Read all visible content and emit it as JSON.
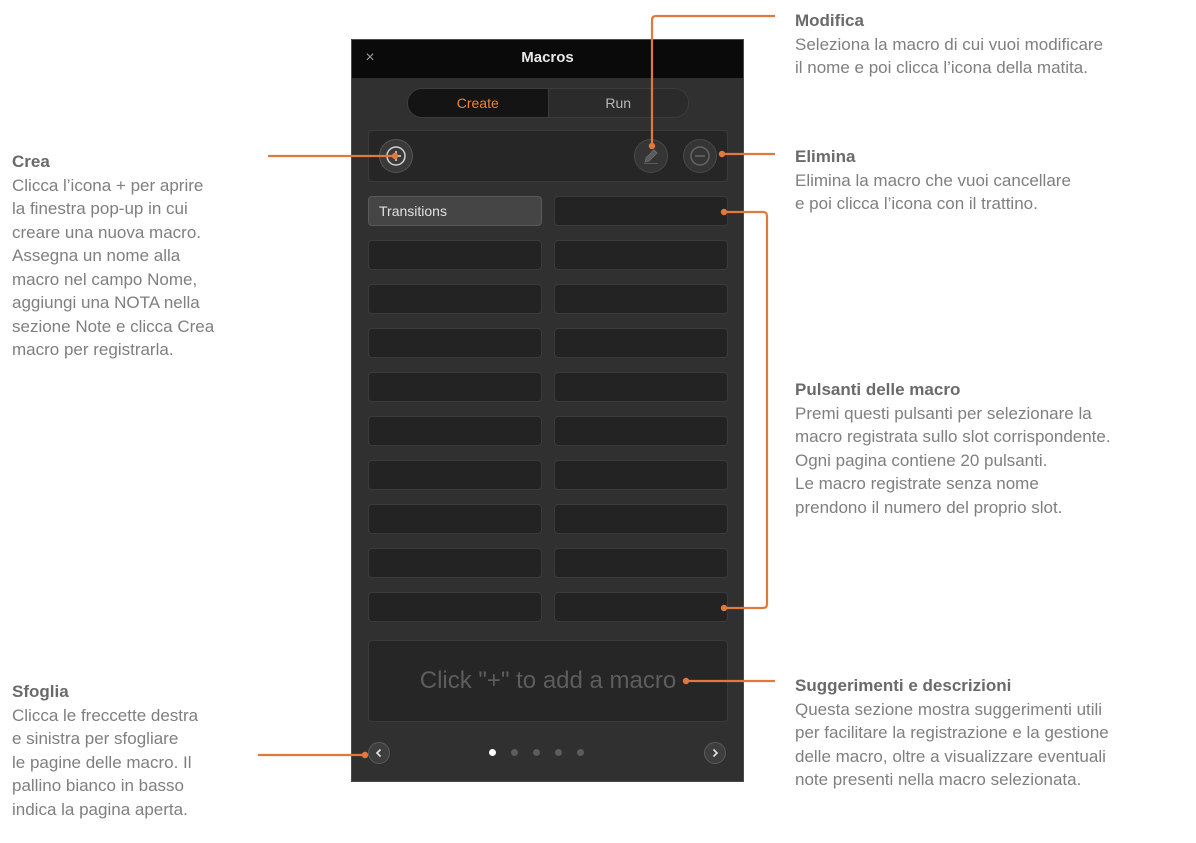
{
  "window": {
    "title": "Macros",
    "close_label": "×"
  },
  "mode_tabs": [
    {
      "label": "Create",
      "active": true
    },
    {
      "label": "Run",
      "active": false
    }
  ],
  "toolbar": {
    "add_icon": "plus-circle-icon",
    "edit_icon": "pencil-icon",
    "delete_icon": "minus-circle-icon"
  },
  "slots": [
    {
      "label": "Transitions"
    },
    {
      "label": ""
    },
    {
      "label": ""
    },
    {
      "label": ""
    },
    {
      "label": ""
    },
    {
      "label": ""
    },
    {
      "label": ""
    },
    {
      "label": ""
    },
    {
      "label": ""
    },
    {
      "label": ""
    },
    {
      "label": ""
    },
    {
      "label": ""
    },
    {
      "label": ""
    },
    {
      "label": ""
    },
    {
      "label": ""
    },
    {
      "label": ""
    },
    {
      "label": ""
    },
    {
      "label": ""
    },
    {
      "label": ""
    },
    {
      "label": ""
    }
  ],
  "hint": "Click \"+\" to add a macro",
  "pagination": {
    "pages": 5,
    "current": 1,
    "prev_icon": "chevron-left-icon",
    "next_icon": "chevron-right-icon"
  },
  "colors": {
    "accent": "#e8833a",
    "leader_line": "#e07a3c",
    "panel_bg": "#303030",
    "titlebar_bg": "#0a0a0a"
  },
  "annotations": {
    "crea": {
      "title": "Crea",
      "body": "Clicca l’icona + per aprire\nla finestra pop-up in cui\ncreare una nuova macro.\nAssegna un nome alla\nmacro nel campo Nome,\naggiungi una NOTA  nella\nsezione Note e clicca Crea\nmacro per registrarla."
    },
    "sfoglia": {
      "title": "Sfoglia",
      "body": "Clicca le freccette destra\ne sinistra per sfogliare\nle pagine delle macro. Il\npallino bianco in basso\nindica la pagina aperta."
    },
    "modifica": {
      "title": "Modifica",
      "body": "Seleziona la macro di cui vuoi modificare\nil nome e poi clicca l’icona della matita."
    },
    "elimina": {
      "title": "Elimina",
      "body": "Elimina la macro che vuoi cancellare\ne poi clicca l’icona con il trattino."
    },
    "pulsanti": {
      "title": "Pulsanti delle macro",
      "body": "Premi questi pulsanti per selezionare la\nmacro registrata sullo slot corrispondente.\nOgni pagina contiene 20 pulsanti.\nLe macro registrate senza nome\nprendono il numero del proprio slot."
    },
    "suggerimenti": {
      "title": "Suggerimenti e descrizioni",
      "body": "Questa sezione mostra suggerimenti utili\nper facilitare la registrazione e la gestione\ndelle macro, oltre a visualizzare eventuali\nnote presenti nella macro selezionata."
    }
  }
}
